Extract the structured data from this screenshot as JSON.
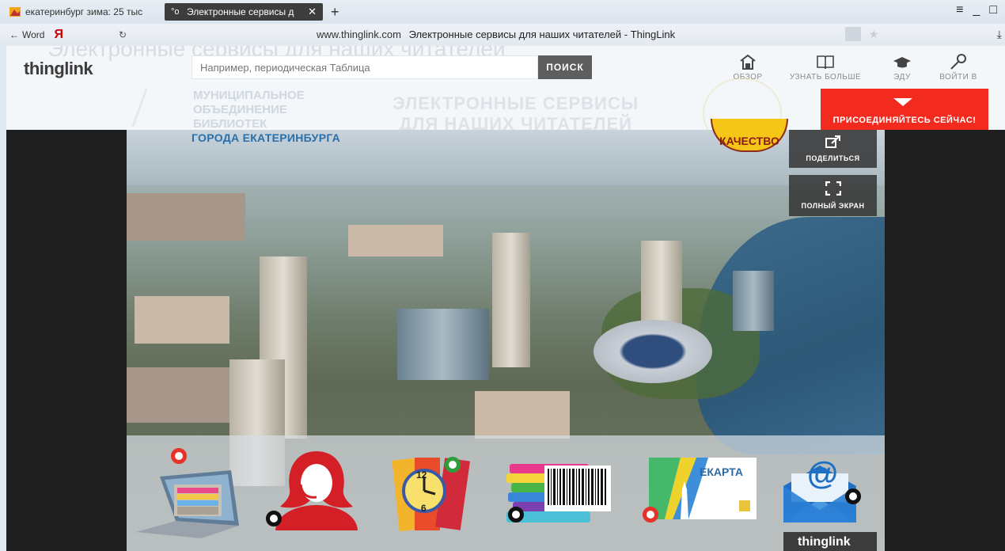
{
  "browser": {
    "tabs": [
      {
        "label": "екатеринбург зима: 25 тыс",
        "active": false
      },
      {
        "label": "Электронные сервисы д",
        "active": true
      }
    ],
    "new_tab": "+",
    "window_controls": [
      "≡",
      "_",
      "□"
    ],
    "back_label": "Word",
    "yandex_label": "Я",
    "url_host": "www.thinglink.com",
    "page_title": "Электронные сервисы для наших читателей - ThingLink"
  },
  "header": {
    "ghost_title": "Электронные сервисы для наших читателей",
    "logo": "thinglink",
    "search_placeholder": "Например, периодическая Таблица",
    "search_button": "ПОИСК",
    "nav": [
      {
        "label": "ОБЗОР",
        "icon": "home-icon"
      },
      {
        "label": "УЗНАТЬ БОЛЬШЕ",
        "icon": "book-icon"
      },
      {
        "label": "ЭДУ",
        "icon": "graduation-cap-icon"
      },
      {
        "label": "ВОЙТИ В",
        "icon": "key-icon"
      }
    ],
    "join_label": "ПРИСОЕДИНЯЙТЕСЬ СЕЙЧАС!"
  },
  "banner": {
    "org_ghost": "МУНИЦИПАЛЬНОЕ\nОБЪЕДИНЕНИЕ\nБИБЛИОТЕК",
    "org_title": "ГОРОДА ЕКАТЕРИНБУРГА",
    "heading_ghost": "ЭЛЕКТРОННЫЕ СЕРВИСЫ\nДЛЯ НАШИХ ЧИТАТЕЛЕЙ",
    "seal_label": "КАЧЕСТВО"
  },
  "viewer": {
    "share_label": "ПОДЕЛИТЬСЯ",
    "fullscreen_label": "ПОЛНЫЙ ЭКРАН",
    "badge": "thinglink"
  },
  "services": [
    {
      "name": "catalog",
      "icon": "file-cabinet-laptop-icon",
      "hotspot": "red"
    },
    {
      "name": "consultant",
      "icon": "operator-headset-icon",
      "hotspot": "black"
    },
    {
      "name": "books",
      "icon": "books-clock-icon",
      "hotspot": "green"
    },
    {
      "name": "barcode",
      "icon": "books-barcode-icon",
      "hotspot": "black"
    },
    {
      "name": "ekarta",
      "icon": "ekarta-map-icon",
      "label": "ЕКАРТА",
      "hotspot": "red"
    },
    {
      "name": "email",
      "icon": "email-envelope-icon",
      "symbol": "@",
      "hotspot": "black"
    }
  ],
  "colors": {
    "join_red": "#f32b1f",
    "org_blue": "#2b6fa8",
    "hotspot_red": "#e5322b",
    "hotspot_green": "#2f9e3a"
  }
}
